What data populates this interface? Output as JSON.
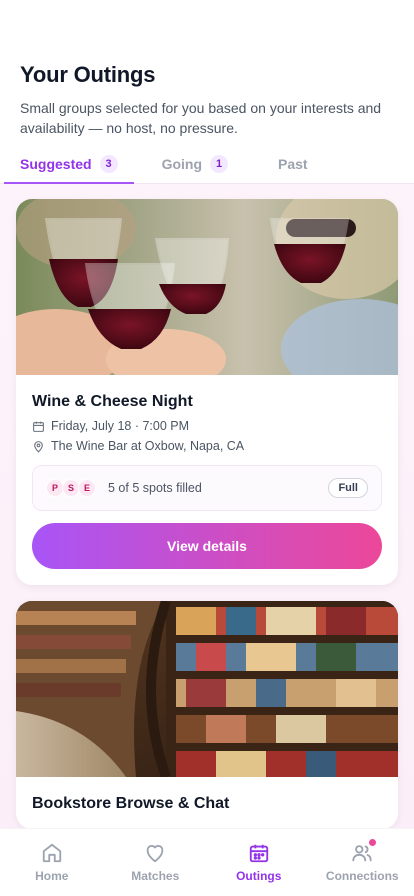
{
  "header": {
    "title": "Your Outings",
    "subtitle": "Small groups selected for you based on your interests and availability — no host, no pressure."
  },
  "tabs": [
    {
      "label": "Suggested",
      "count": "3",
      "active": true
    },
    {
      "label": "Going",
      "count": "1",
      "active": false
    },
    {
      "label": "Past",
      "active": false
    }
  ],
  "cards": [
    {
      "title": "Wine & Cheese Night",
      "date": "Friday, July 18 · 7:00 PM",
      "location": "The Wine Bar at Oxbow, Napa, CA",
      "avatars": [
        "P",
        "S",
        "E"
      ],
      "spots": "5 of 5 spots filled",
      "status": "Full",
      "button": "View details",
      "image": "wine-glasses-toast-photo"
    },
    {
      "title": "Bookstore Browse & Chat",
      "image": "curved-library-bookshelves-photo"
    }
  ],
  "nav": [
    {
      "label": "Home",
      "icon": "home-icon"
    },
    {
      "label": "Matches",
      "icon": "heart-icon"
    },
    {
      "label": "Outings",
      "icon": "calendar-icon",
      "active": true
    },
    {
      "label": "Connections",
      "icon": "people-icon",
      "badge": true
    }
  ],
  "colors": {
    "accent": "#9333ea",
    "gradient_start": "#a855f7",
    "gradient_end": "#ec4899",
    "notification": "#ec4899"
  }
}
